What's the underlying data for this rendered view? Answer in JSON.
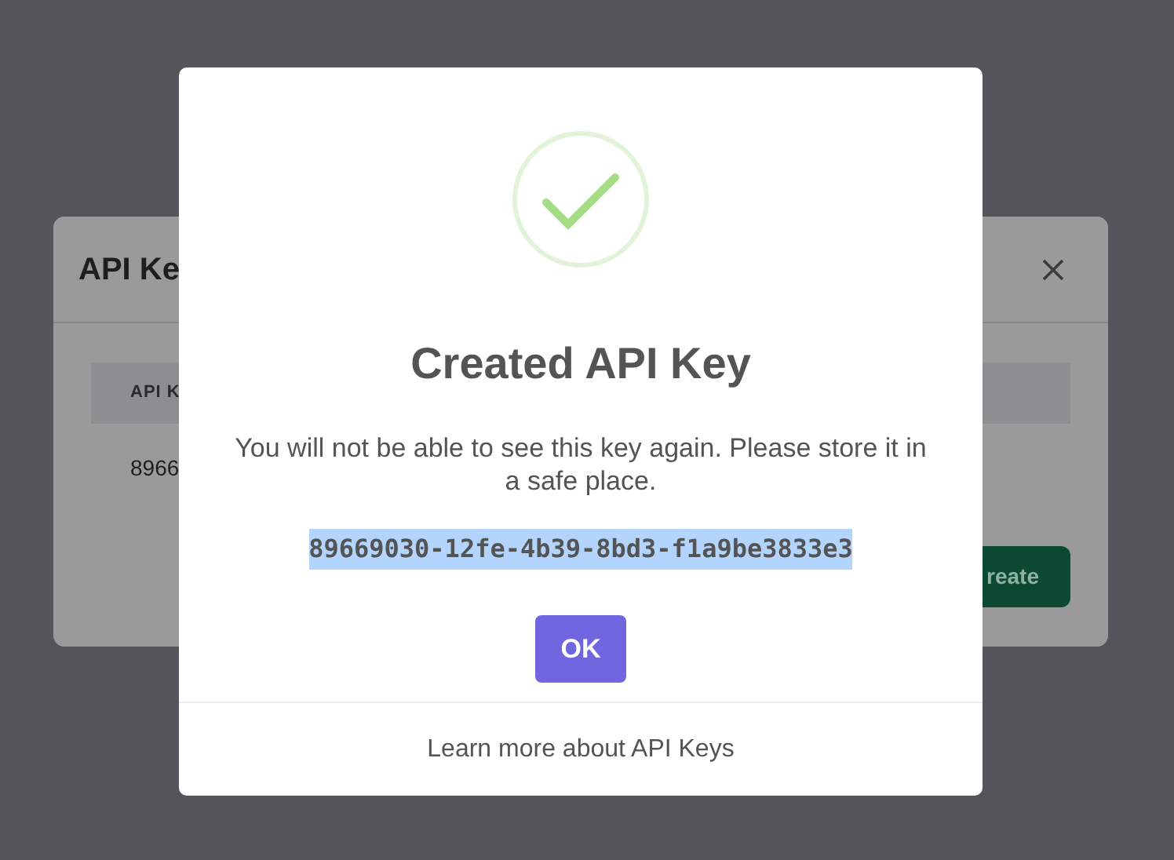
{
  "background_dialog": {
    "title": "API Ke",
    "table": {
      "columns": [
        "API K"
      ],
      "rows": [
        [
          "8966"
        ]
      ]
    },
    "buttons": [
      "reate"
    ]
  },
  "dialog": {
    "title": "Created API Key",
    "message": "You will not be able to see this key again. Please store it in a safe place.",
    "api_key": "89669030-12fe-4b39-8bd3-f1a9be3833e3",
    "api_key_selected": true,
    "buttons": [
      "OK"
    ],
    "footer_link": "Learn more about API Keys"
  }
}
